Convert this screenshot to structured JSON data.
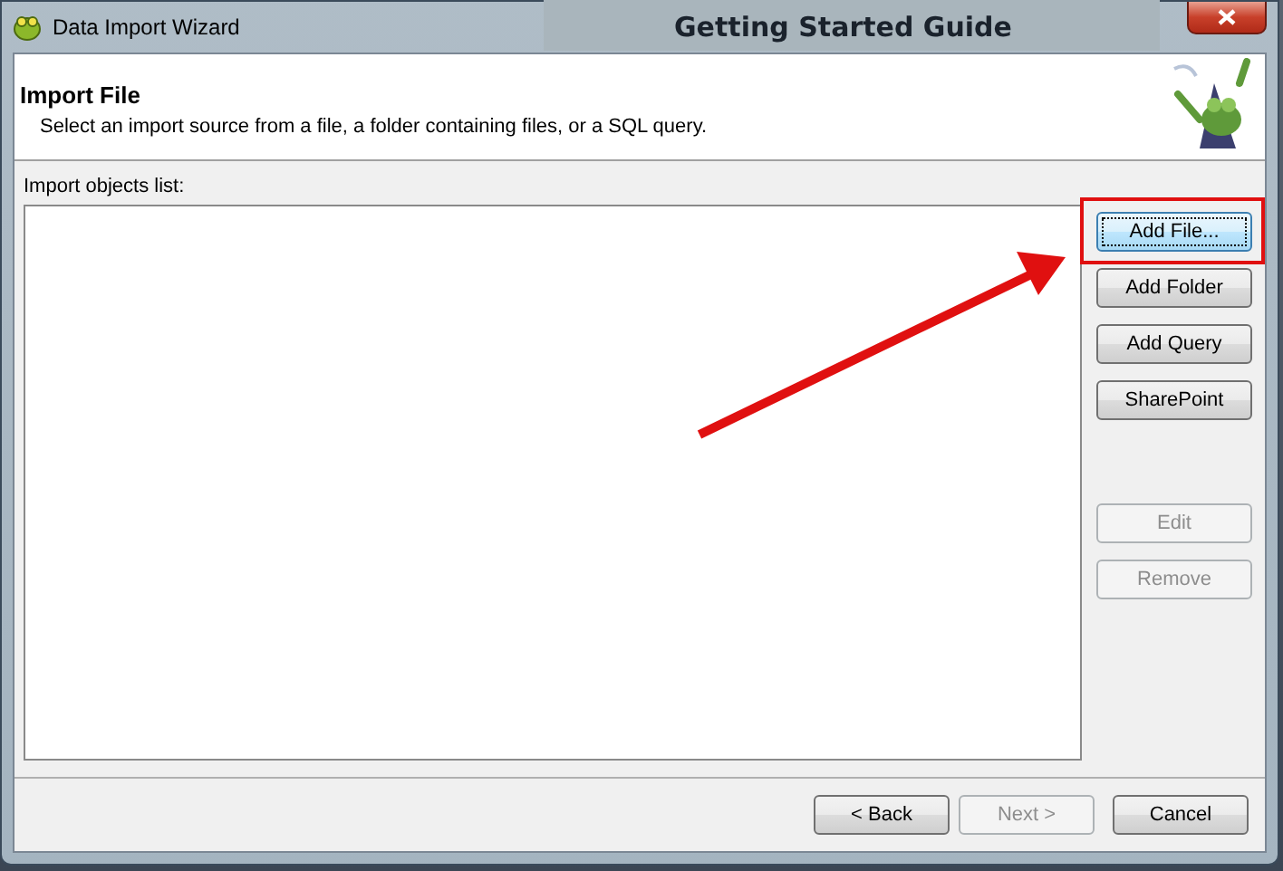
{
  "background_window": {
    "title": "Getting Started Guide"
  },
  "window": {
    "title": "Data Import Wizard"
  },
  "header": {
    "title": "Import File",
    "description": "Select an import source from a file, a folder containing files, or a SQL query."
  },
  "list": {
    "label": "Import objects list:"
  },
  "side_buttons": [
    {
      "label": "Add File...",
      "disabled": false,
      "focused": true,
      "highlighted": true
    },
    {
      "label": "Add Folder",
      "disabled": false,
      "focused": false,
      "highlighted": false
    },
    {
      "label": "Add Query",
      "disabled": false,
      "focused": false,
      "highlighted": false
    },
    {
      "label": "SharePoint",
      "disabled": false,
      "focused": false,
      "highlighted": false
    },
    {
      "label": "Edit",
      "disabled": true,
      "focused": false,
      "highlighted": false
    },
    {
      "label": "Remove",
      "disabled": true,
      "focused": false,
      "highlighted": false
    }
  ],
  "footer_buttons": [
    {
      "label": "< Back",
      "disabled": false
    },
    {
      "label": "Next >",
      "disabled": true
    },
    {
      "label": "Cancel",
      "disabled": false
    }
  ]
}
